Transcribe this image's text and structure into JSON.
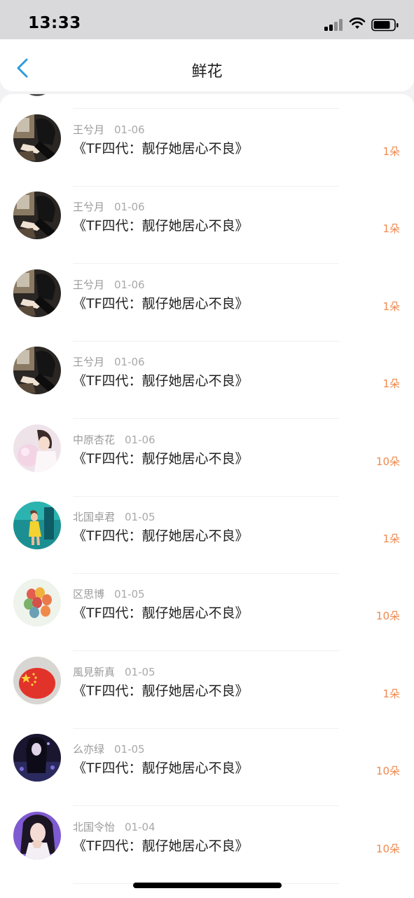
{
  "status_bar": {
    "time": "13:33"
  },
  "header": {
    "title": "鲜花"
  },
  "colors": {
    "count_accent": "#ef8a50",
    "back_arrow": "#2c9cdb"
  },
  "items": [
    {
      "user": "王兮月",
      "date": "01-06",
      "title": "《TF四代：靓仔她居心不良》",
      "count": "1朵",
      "avatar": "dark-photo"
    },
    {
      "user": "王兮月",
      "date": "01-06",
      "title": "《TF四代：靓仔她居心不良》",
      "count": "1朵",
      "avatar": "dark-photo"
    },
    {
      "user": "王兮月",
      "date": "01-06",
      "title": "《TF四代：靓仔她居心不良》",
      "count": "1朵",
      "avatar": "dark-photo"
    },
    {
      "user": "王兮月",
      "date": "01-06",
      "title": "《TF四代：靓仔她居心不良》",
      "count": "1朵",
      "avatar": "dark-photo"
    },
    {
      "user": "中原杏花",
      "date": "01-06",
      "title": "《TF四代：靓仔她居心不良》",
      "count": "10朵",
      "avatar": "pink-girl"
    },
    {
      "user": "北国卓君",
      "date": "01-05",
      "title": "《TF四代：靓仔她居心不良》",
      "count": "1朵",
      "avatar": "teal-girl"
    },
    {
      "user": "区思博",
      "date": "01-05",
      "title": "《TF四代：靓仔她居心不良》",
      "count": "10朵",
      "avatar": "balloons"
    },
    {
      "user": "風見新真",
      "date": "01-05",
      "title": "《TF四代：靓仔她居心不良》",
      "count": "1朵",
      "avatar": "red-flag"
    },
    {
      "user": "么亦绿",
      "date": "01-05",
      "title": "《TF四代：靓仔她居心不良》",
      "count": "10朵",
      "avatar": "purple-dark"
    },
    {
      "user": "北国令怡",
      "date": "01-04",
      "title": "《TF四代：靓仔她居心不良》",
      "count": "10朵",
      "avatar": "purple-girl"
    }
  ]
}
